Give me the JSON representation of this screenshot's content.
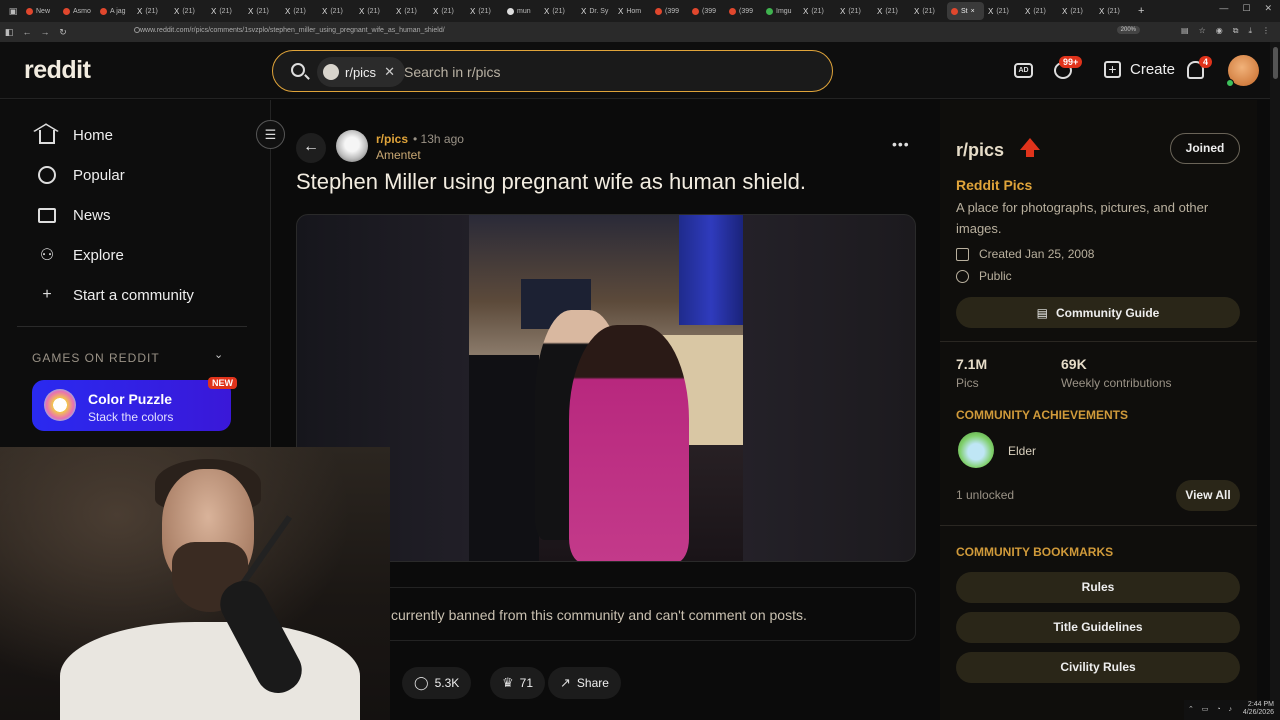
{
  "browser": {
    "tabs": [
      {
        "label": "New",
        "icon": "reddit-icon"
      },
      {
        "label": "Asmo",
        "icon": "reddit-icon"
      },
      {
        "label": "A jag",
        "icon": "reddit-icon"
      },
      {
        "label": "(21)",
        "icon": "x-icon"
      },
      {
        "label": "(21)",
        "icon": "x-icon"
      },
      {
        "label": "(21)",
        "icon": "x-icon"
      },
      {
        "label": "(21)",
        "icon": "x-icon"
      },
      {
        "label": "(21)",
        "icon": "x-icon"
      },
      {
        "label": "(21)",
        "icon": "x-icon"
      },
      {
        "label": "(21)",
        "icon": "x-icon"
      },
      {
        "label": "(21)",
        "icon": "x-icon"
      },
      {
        "label": "(21)",
        "icon": "x-icon"
      },
      {
        "label": "(21)",
        "icon": "x-icon"
      },
      {
        "label": "mun",
        "icon": "github-icon"
      },
      {
        "label": "(21)",
        "icon": "x-icon"
      },
      {
        "label": "Dr. Sy",
        "icon": "x-icon"
      },
      {
        "label": "Hom",
        "icon": "x-icon"
      },
      {
        "label": "(399",
        "icon": "youtube-icon"
      },
      {
        "label": "(399",
        "icon": "youtube-icon"
      },
      {
        "label": "(399",
        "icon": "youtube-icon"
      },
      {
        "label": "Imgu",
        "icon": "imgur-icon"
      },
      {
        "label": "(21)",
        "icon": "x-icon"
      },
      {
        "label": "(21)",
        "icon": "x-icon"
      },
      {
        "label": "(21)",
        "icon": "x-icon"
      },
      {
        "label": "(21)",
        "icon": "x-icon"
      },
      {
        "label": "St",
        "icon": "reddit-icon",
        "active": true
      },
      {
        "label": "(21)",
        "icon": "x-icon"
      },
      {
        "label": "(21)",
        "icon": "x-icon"
      },
      {
        "label": "(21)",
        "icon": "x-icon"
      },
      {
        "label": "(21)",
        "icon": "x-icon"
      }
    ],
    "url": "www.reddit.com/r/pics/comments/1svzplo/stephen_miller_using_pregnant_wife_as_human_shield/",
    "zoom": "200%"
  },
  "header": {
    "logo": "reddit",
    "search_chip": "r/pics",
    "search_placeholder": "Search in r/pics",
    "chat_badge": "99+",
    "create_label": "Create",
    "notif_badge": "4"
  },
  "sidebar": {
    "items": [
      {
        "label": "Home",
        "icon": "home-icon"
      },
      {
        "label": "Popular",
        "icon": "popular-icon"
      },
      {
        "label": "News",
        "icon": "news-icon"
      },
      {
        "label": "Explore",
        "icon": "explore-icon"
      },
      {
        "label": "Start a community",
        "icon": "plus-icon"
      }
    ],
    "games_header": "GAMES ON REDDIT",
    "game_title": "Color Puzzle",
    "game_sub": "Stack the colors",
    "game_badge": "NEW"
  },
  "post": {
    "subreddit": "r/pics",
    "time": "• 13h ago",
    "author": "Amentet",
    "title": "Stephen Miller using pregnant wife as human shield.",
    "banned_text": "currently banned from this community and can't comment on posts.",
    "comments": "5.3K",
    "awards": "71",
    "share": "Share"
  },
  "community": {
    "name": "r/pics",
    "joined": "Joined",
    "title": "Reddit Pics",
    "description": "A place for photographs, pictures, and other images.",
    "created": "Created Jan 25, 2008",
    "visibility": "Public",
    "guide": "Community Guide",
    "members": "7.1M",
    "members_label": "Pics",
    "contributions": "69K",
    "contributions_label": "Weekly contributions",
    "achievements_header": "COMMUNITY ACHIEVEMENTS",
    "achievement": "Elder",
    "unlocked": "1 unlocked",
    "view_all": "View All",
    "bookmarks_header": "COMMUNITY BOOKMARKS",
    "bookmarks": [
      "Rules",
      "Title Guidelines",
      "Civility Rules"
    ]
  },
  "tray": {
    "time": "2:44 PM",
    "date": "4/26/2026"
  },
  "colors": {
    "accent": "#e0a43a",
    "reddit_orange": "#e0331b",
    "game_card": "#2a2af0"
  }
}
